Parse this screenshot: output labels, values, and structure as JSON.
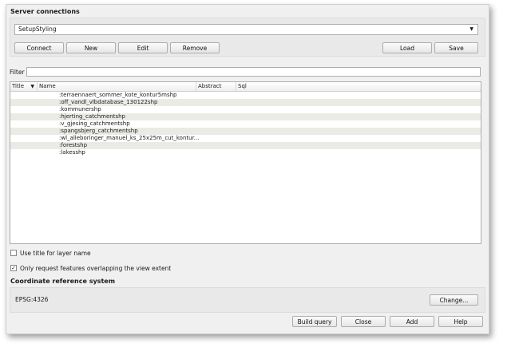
{
  "server_connections": {
    "title": "Server connections",
    "selected_connection": "SetupStyling",
    "buttons": {
      "connect": "Connect",
      "new": "New",
      "edit": "Edit",
      "remove": "Remove",
      "load": "Load",
      "save": "Save"
    }
  },
  "filter": {
    "label": "Filter",
    "value": ""
  },
  "table": {
    "columns": [
      "Title",
      "Name",
      "Abstract",
      "Sql"
    ],
    "rows": [
      ":terraennaert_sommer_kote_kontur5mshp",
      ":off_vandl_vlbdatabase_130122shp",
      ":kommunershp",
      ":hjerting_catchmentshp",
      ":v_gjesing_catchmentshp",
      ":spangsbjerg_catchmentshp",
      ":wl_alleboringer_manuel_ks_25x25m_cut_kontur...",
      ":forestshp",
      ":lakesshp"
    ]
  },
  "options": {
    "use_title": {
      "label": "Use title for layer name",
      "checked": false
    },
    "only_request": {
      "label": "Only request features overlapping the view extent",
      "checked": true
    }
  },
  "crs": {
    "title": "Coordinate reference system",
    "value": "EPSG:4326",
    "change_button": "Change..."
  },
  "footer": {
    "build_query": "Build query",
    "close": "Close",
    "add": "Add",
    "help": "Help"
  },
  "icons": {
    "sort": "sort-down-icon",
    "dropdown": "chevron-down-icon",
    "check": "checkmark-icon"
  }
}
